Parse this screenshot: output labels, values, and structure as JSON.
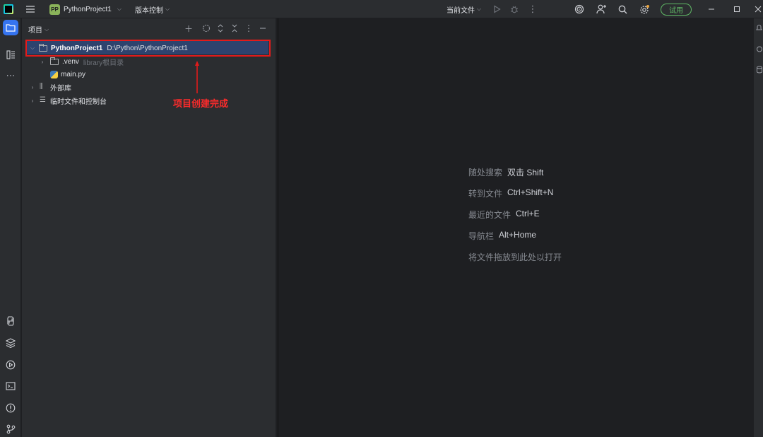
{
  "titlebar": {
    "project_badge": "PP",
    "project_name": "PythonProject1",
    "vcs_label": "版本控制",
    "current_file_label": "当前文件",
    "trial_label": "试用"
  },
  "project_panel": {
    "title": "项目",
    "tree": [
      {
        "name": "PythonProject1",
        "detail": "D:\\Python\\PythonProject1",
        "icon": "folder-icon",
        "expanded": true
      },
      {
        "name": ".venv",
        "detail": "library根目录",
        "icon": "folder-icon",
        "expanded": false
      },
      {
        "name": "main.py",
        "detail": "",
        "icon": "python-file-icon"
      },
      {
        "name": "外部库",
        "detail": "",
        "icon": "library-icon",
        "expanded": false
      },
      {
        "name": "临时文件和控制台",
        "detail": "",
        "icon": "scratches-icon",
        "expanded": false
      }
    ]
  },
  "annotation": {
    "text": "项目创建完成",
    "color": "#e21b1b"
  },
  "editor_hints": [
    {
      "action": "随处搜索",
      "shortcut": "双击 Shift"
    },
    {
      "action": "转到文件",
      "shortcut": "Ctrl+Shift+N"
    },
    {
      "action": "最近的文件",
      "shortcut": "Ctrl+E"
    },
    {
      "action": "导航栏",
      "shortcut": "Alt+Home"
    },
    {
      "action": "将文件拖放到此处以打开",
      "shortcut": ""
    }
  ],
  "colors": {
    "accent": "#3574f0",
    "selection": "#2e436e",
    "trial": "#5fb865"
  }
}
